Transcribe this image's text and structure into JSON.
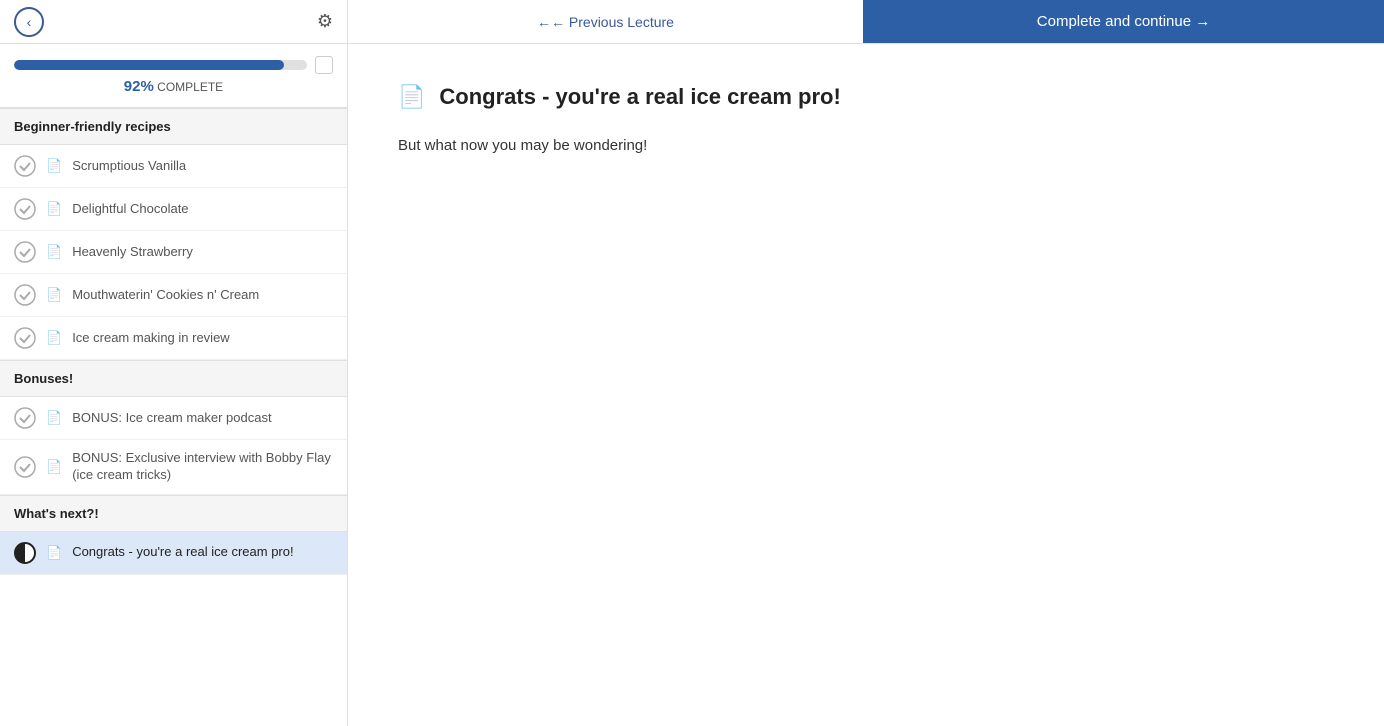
{
  "nav": {
    "back_label": "←",
    "gear_label": "⚙",
    "previous_lecture_label": "← Previous Lecture",
    "complete_label": "Complete and continue →"
  },
  "progress": {
    "percentage": 92,
    "percentage_label": "92%",
    "complete_label": "COMPLETE",
    "bar_width": "92%"
  },
  "sidebar": {
    "sections": [
      {
        "id": "beginner",
        "header": "Beginner-friendly recipes",
        "items": [
          {
            "id": "vanilla",
            "title": "Scrumptious Vanilla",
            "completed": true,
            "active": false
          },
          {
            "id": "chocolate",
            "title": "Delightful Chocolate",
            "completed": true,
            "active": false
          },
          {
            "id": "strawberry",
            "title": "Heavenly Strawberry",
            "completed": true,
            "active": false
          },
          {
            "id": "cookies",
            "title": "Mouthwaterin' Cookies n' Cream",
            "completed": true,
            "active": false
          },
          {
            "id": "review",
            "title": "Ice cream making in review",
            "completed": true,
            "active": false
          }
        ]
      },
      {
        "id": "bonuses",
        "header": "Bonuses!",
        "items": [
          {
            "id": "podcast",
            "title": "BONUS: Ice cream maker podcast",
            "completed": true,
            "active": false
          },
          {
            "id": "interview",
            "title": "BONUS: Exclusive interview with Bobby Flay (ice cream tricks)",
            "completed": true,
            "active": false
          }
        ]
      },
      {
        "id": "whatsnext",
        "header": "What's next?!",
        "items": [
          {
            "id": "congrats",
            "title": "Congrats - you're a real ice cream pro!",
            "completed": false,
            "active": true,
            "half": true
          }
        ]
      }
    ]
  },
  "content": {
    "icon": "📄",
    "title": "Congrats - you're a real ice cream pro!",
    "body": "But what now you may be wondering!"
  }
}
